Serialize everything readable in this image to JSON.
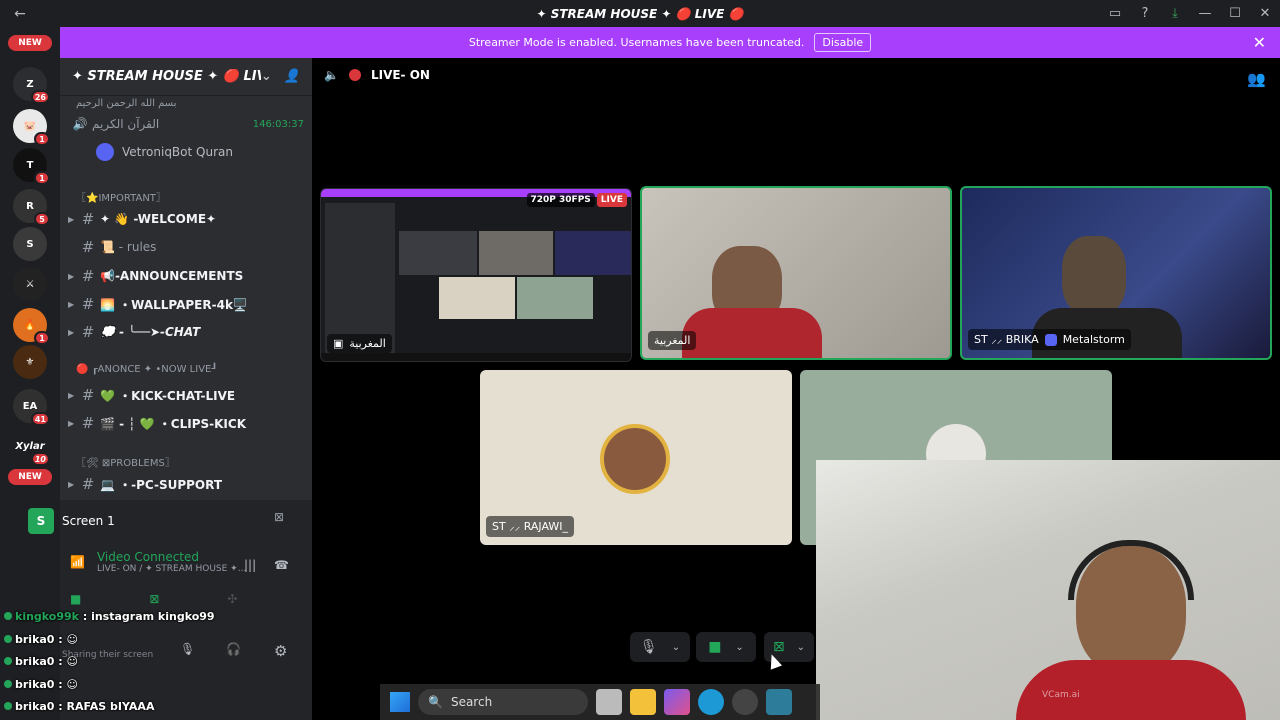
{
  "titlebar": {
    "title": "✦ STREAM HOUSE ✦ 🔴 LIVE 🔴",
    "back_icon": "arrow-left-icon"
  },
  "banner": {
    "text": "Streamer Mode is enabled. Usernames have been truncated.",
    "disable_label": "Disable"
  },
  "rail": {
    "new_label_top": "NEW",
    "new_label_mid": "NEW",
    "servers": [
      {
        "letter": "Z",
        "count": "26",
        "color": "#2b2d31"
      },
      {
        "letter": "🐷",
        "count": "1",
        "color": "#f7f7f7"
      },
      {
        "letter": "T",
        "count": "1",
        "color": "#111"
      },
      {
        "letter": "R",
        "count": "5",
        "color": "#333"
      },
      {
        "letter": "S",
        "count": "",
        "color": "#3a3a3a"
      },
      {
        "letter": "⚔",
        "count": "",
        "color": "#222"
      },
      {
        "letter": "🔥",
        "count": "1",
        "color": "#e07020"
      },
      {
        "letter": "⚜",
        "count": "",
        "color": "#4a2a10"
      },
      {
        "letter": "EA",
        "count": "41",
        "color": "#303030"
      },
      {
        "letter": "Xylar",
        "count": "10",
        "color": "#1e1f22"
      }
    ]
  },
  "channels": {
    "server_name": "✦ STREAM HOUSE ✦ 🔴 LIV...",
    "top_category": "بسم الله الرحمن الرحيم",
    "quran_channel": "القرآن الكريم",
    "quran_timer": "146:03:37",
    "quran_bot": "VetroniqBot Quran",
    "cat_important": "〖⭐IMPORTANT〗",
    "welcome": "✦ 👋 -WELCOME✦",
    "rules": "📜 - rules",
    "announcements": "📢-ANNOUNCEMENTS",
    "wallpaper": "🌅 ・WALLPAPER-4k🖥️",
    "chat": "💭 - ╰──➤-CHAT",
    "cat_live": "🔴 ┎ANONCE ✦ •NOW LIVE┚",
    "kick_chat": "💚 ・KICK-CHAT-LIVE",
    "clips": "🎬 - ┆ 💚 ・CLIPS-KICK",
    "cat_problems": "〖🛠 ⊠PROBLEMS〗",
    "pc_support": "💻 ・-PC-SUPPORT"
  },
  "voice_panel": {
    "screen_title": "Screen 1",
    "status": "Video Connected",
    "channel": "LIVE- ON / ✦ STREAM HOUSE ✦...",
    "sharing": "Sharing their screen"
  },
  "stage": {
    "channel_name": "LIVE- ON",
    "stream_badge_quality": "720P 30FPS",
    "stream_badge_live": "LIVE",
    "tile1_name": "المغربية",
    "tile2_name": "المغربية",
    "tile3_name": "ST ⸝⸝ BRIKA",
    "tile3_extra": "Metalstorm",
    "tile4_name": "ST ⸝⸝ RAJAWI_"
  },
  "chat_overlay": [
    {
      "user": "kingko99k",
      "text": "instagram kingko99"
    },
    {
      "user": "brika0",
      "text": ""
    },
    {
      "user": "brika0",
      "text": ""
    },
    {
      "user": "brika0",
      "text": ""
    },
    {
      "user": "brika0",
      "text": "RAFAS bIYAAA"
    }
  ],
  "taskbar": {
    "search_placeholder": "Search"
  },
  "webcam": {
    "watermark": "VCam.ai"
  },
  "colors": {
    "banner": "#a83ffc",
    "accent_green": "#23a55a",
    "danger": "#da373c"
  }
}
